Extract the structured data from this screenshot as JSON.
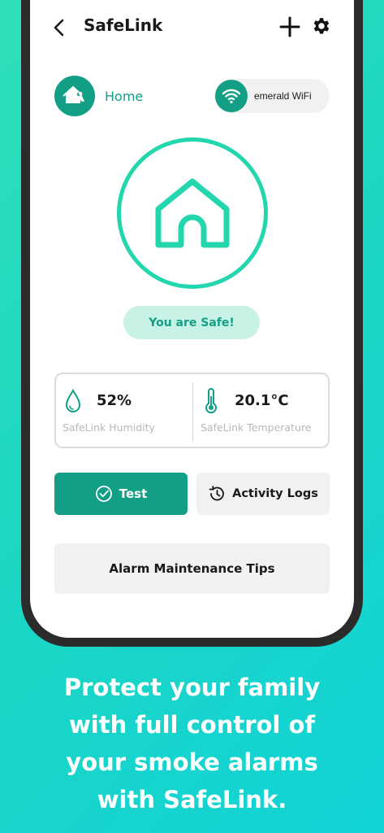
{
  "header": {
    "title": "SafeLink",
    "back_icon": "chevron-left-icon",
    "add_icon": "plus-icon",
    "settings_icon": "gear-icon"
  },
  "location": {
    "label": "Home",
    "icon": "home-person-icon"
  },
  "network": {
    "label": "emerald WiFi",
    "icon": "wifi-icon"
  },
  "status": {
    "icon": "house-outline-icon",
    "label": "You are Safe!"
  },
  "stats": {
    "humidity": {
      "value": "52%",
      "caption": "SafeLink Humidity",
      "icon": "droplet-icon"
    },
    "temperature": {
      "value": "20.1°C",
      "caption": "SafeLink Temperature",
      "icon": "thermometer-icon"
    }
  },
  "actions": {
    "test_label": "Test",
    "logs_label": "Activity Logs",
    "tips_label": "Alarm Maintenance Tips"
  },
  "tagline": {
    "line1": "Protect your family",
    "line2": "with full control of",
    "line3": "your smoke alarms",
    "line4": "with SafeLink."
  },
  "colors": {
    "primary": "#139f86",
    "ring": "#22d6ad",
    "pill": "#c8f2e5",
    "background_start": "#2ee0b8",
    "background_end": "#12d3d6"
  }
}
